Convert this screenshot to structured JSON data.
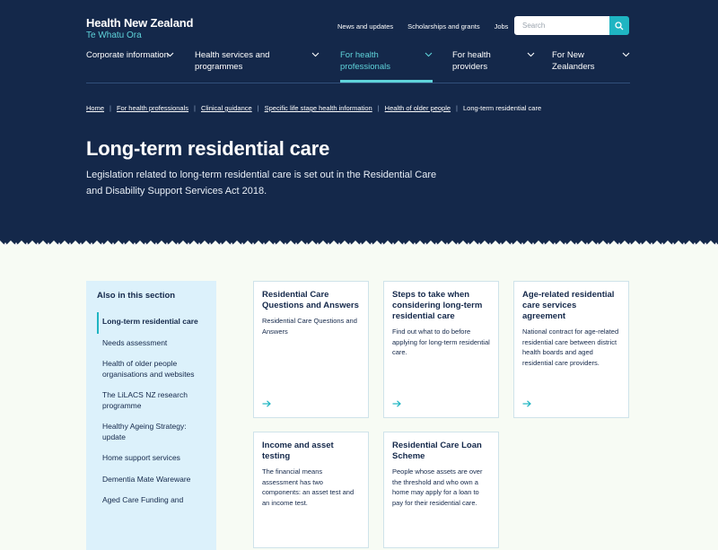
{
  "logo": {
    "name": "Health New Zealand",
    "sub": "Te Whatu Ora"
  },
  "utility_nav": [
    "News and updates",
    "Scholarships and grants",
    "Jobs"
  ],
  "search": {
    "placeholder": "Search"
  },
  "main_nav": [
    {
      "label": "Corporate information"
    },
    {
      "label": "Health services and programmes"
    },
    {
      "label": "For health professionals",
      "active": true
    },
    {
      "label": "For health providers"
    },
    {
      "label": "For New Zealanders"
    }
  ],
  "breadcrumb": [
    "Home",
    "For health professionals",
    "Clinical guidance",
    "Specific life stage health information",
    "Health of older people",
    "Long-term residential care"
  ],
  "page": {
    "title": "Long-term residential care",
    "intro": "Legislation related to long-term residential care is set out in the Residential Care and Disability Support Services Act 2018."
  },
  "sidebar": {
    "title": "Also in this section",
    "items": [
      "Long-term residential care",
      "Needs assessment",
      "Health of older people organisations and websites",
      "The LiLACS NZ research programme",
      "Healthy Ageing Strategy: update",
      "Home support services",
      "Dementia Mate Wareware",
      "Aged Care Funding and"
    ]
  },
  "cards": [
    {
      "title": "Residential Care Questions and Answers",
      "desc": "Residential Care Questions and Answers"
    },
    {
      "title": "Steps to take when considering long-term residential care",
      "desc": "Find out what to do before applying for long-term residential care."
    },
    {
      "title": "Age-related residential care services agreement",
      "desc": "National contract for age-related residential care between district health boards and aged residential care providers."
    },
    {
      "title": "Income and asset testing",
      "desc": "The financial means assessment has two components: an asset test and an income test."
    },
    {
      "title": "Residential Care Loan Scheme",
      "desc": "People whose assets are over the threshold and who own a home may apply for a loan to pay for their residential care."
    }
  ],
  "colors": {
    "navy": "#14284a",
    "accent": "#5fd3da",
    "teal": "#1fb5c2",
    "sidebar_bg": "#dcf1fb"
  }
}
